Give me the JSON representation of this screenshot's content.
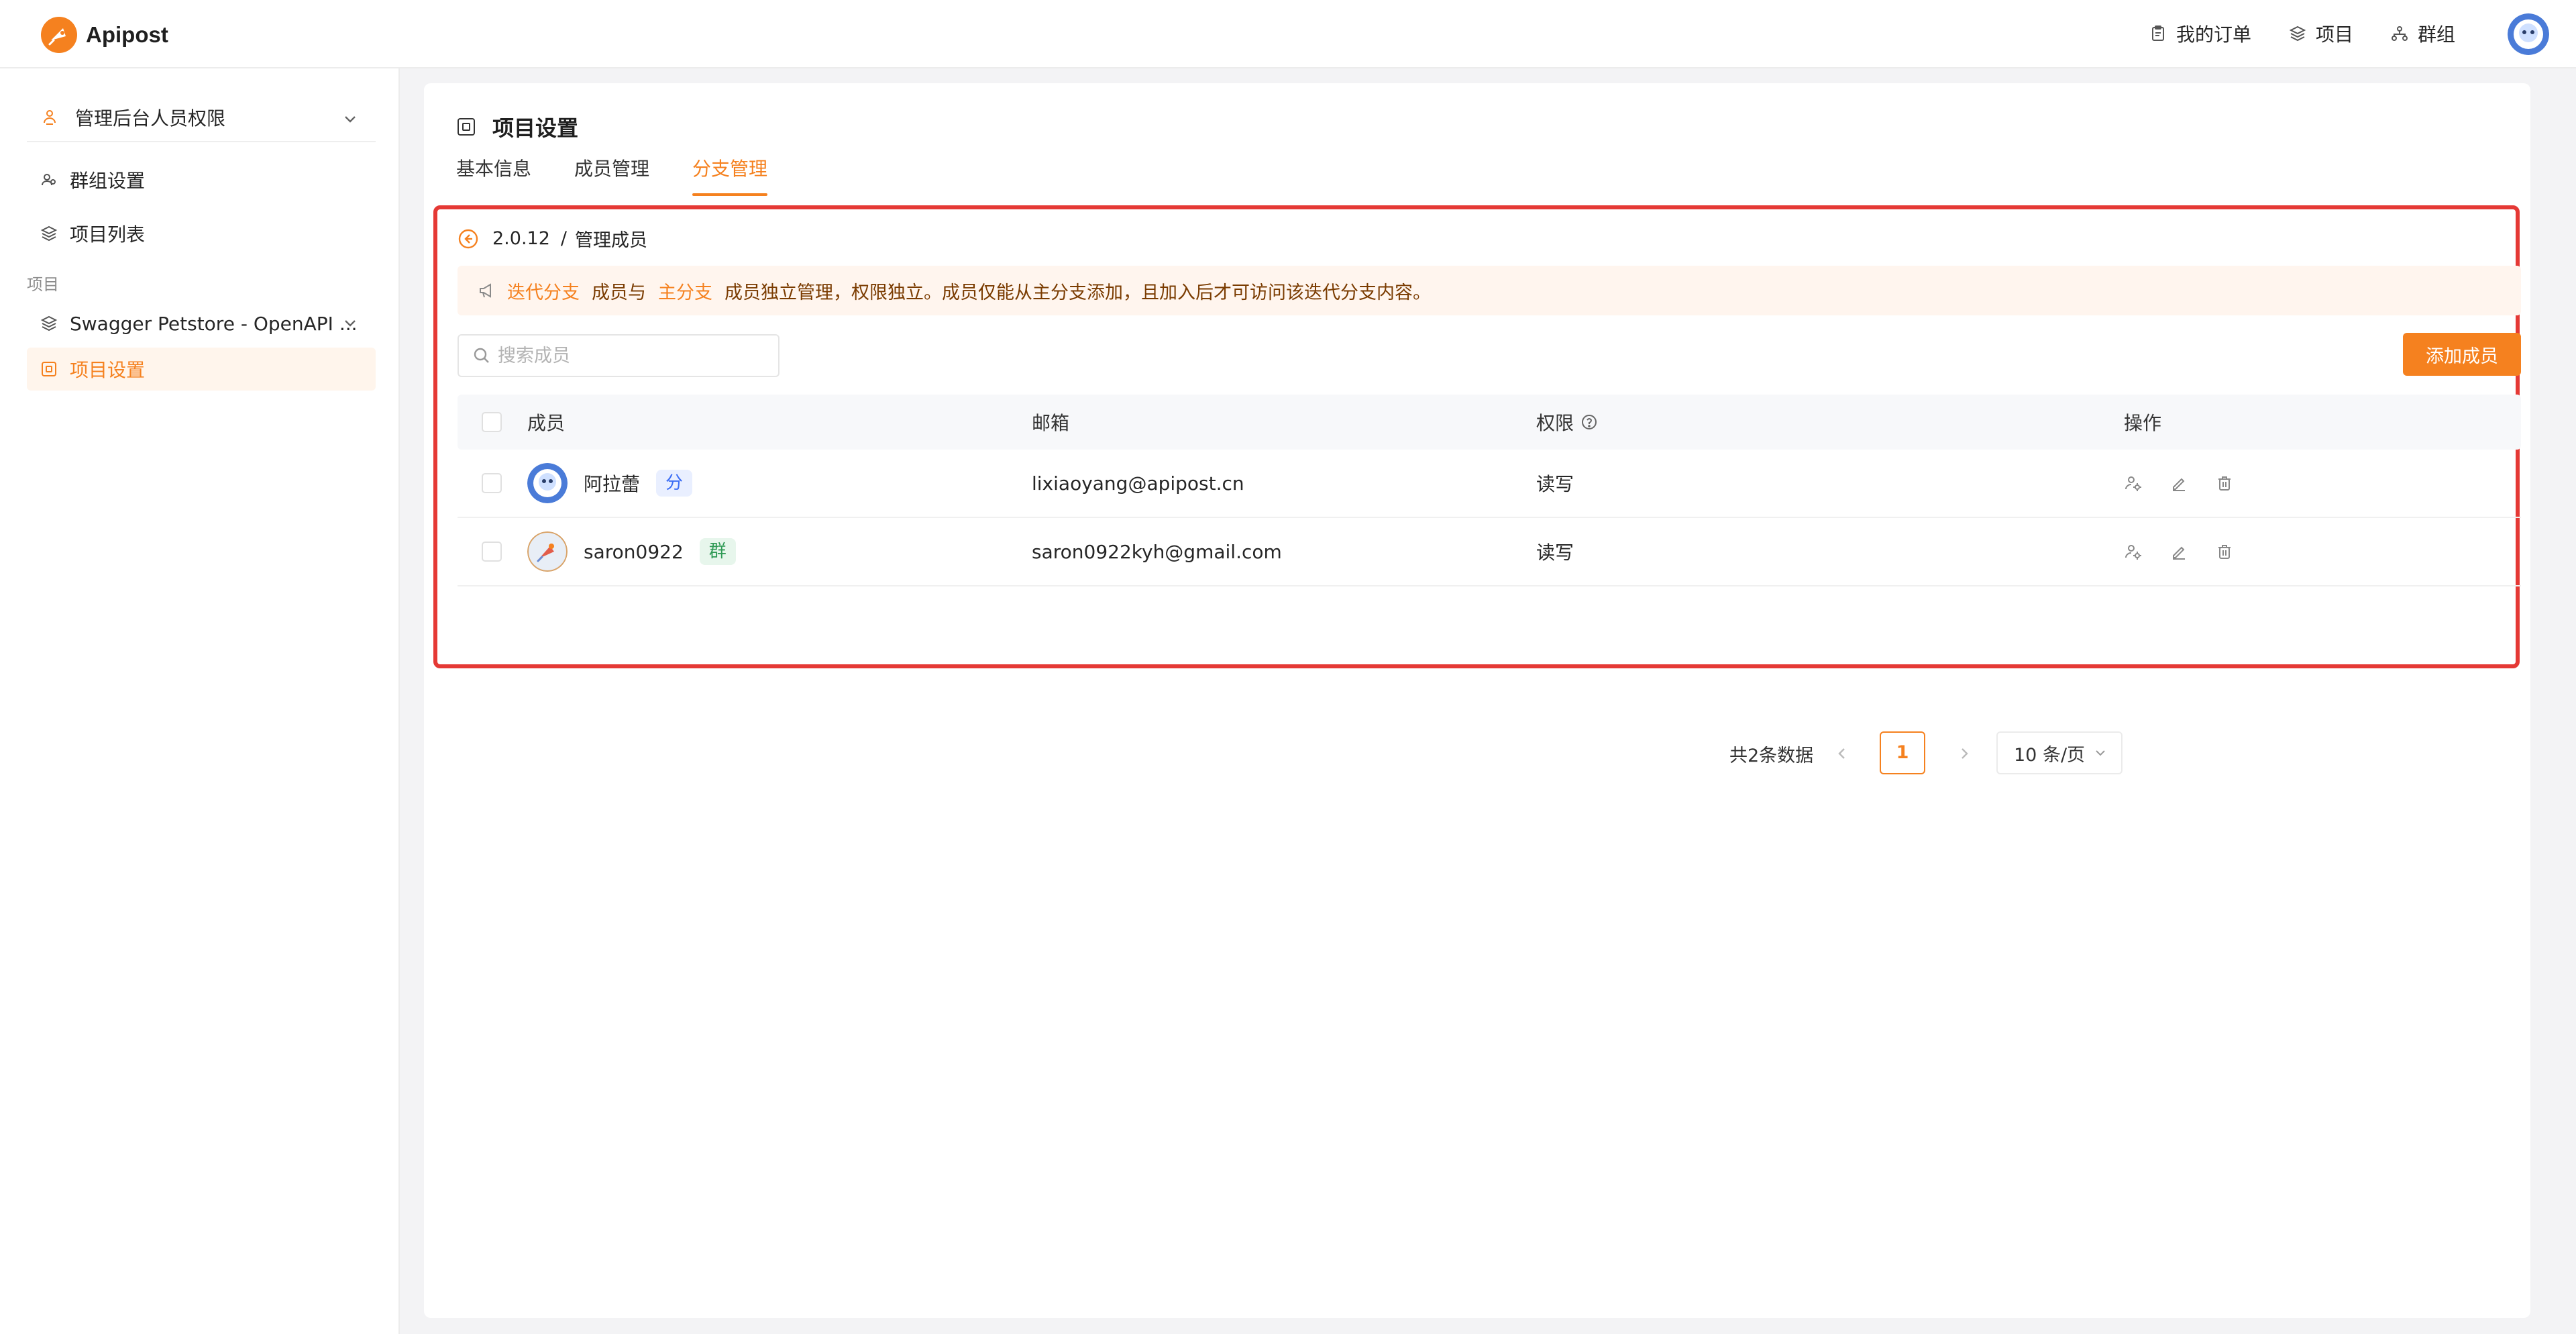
{
  "app": {
    "name": "Apipost"
  },
  "topnav": {
    "items": [
      {
        "label": "我的订单",
        "icon": "clipboard-icon"
      },
      {
        "label": "项目",
        "icon": "layers-icon"
      },
      {
        "label": "群组",
        "icon": "org-icon"
      }
    ]
  },
  "sidebar": {
    "team_select": "管理后台人员权限",
    "items": [
      {
        "label": "群组设置",
        "icon": "group-icon"
      },
      {
        "label": "项目列表",
        "icon": "layers-icon"
      }
    ],
    "section_label": "项目",
    "project": "Swagger Petstore - OpenAPI ...",
    "active_item": "项目设置"
  },
  "main": {
    "title": "项目设置",
    "tabs": [
      {
        "label": "基本信息",
        "active": false
      },
      {
        "label": "成员管理",
        "active": false
      },
      {
        "label": "分支管理",
        "active": true
      }
    ],
    "breadcrumb": {
      "version": "2.0.12",
      "separator": "/",
      "current": "管理成员"
    },
    "notice": {
      "hl1": "迭代分支",
      "text1": "成员与",
      "hl2": "主分支",
      "text2": "成员独立管理，权限独立。成员仅能从主分支添加，且加入后才可访问该迭代分支内容。"
    },
    "search": {
      "placeholder": "搜索成员",
      "value": ""
    },
    "add_button": "添加成员",
    "table": {
      "headers": {
        "member": "成员",
        "email": "邮箱",
        "permission": "权限",
        "actions": "操作"
      },
      "rows": [
        {
          "name": "阿拉蕾",
          "tag": "分",
          "email": "lixiaoyang@apipost.cn",
          "permission": "读写"
        },
        {
          "name": "saron0922",
          "tag": "群",
          "email": "saron0922kyh@gmail.com",
          "permission": "读写"
        }
      ]
    },
    "pagination": {
      "total": "共2条数据",
      "page": "1",
      "page_size": "10 条/页"
    }
  },
  "colors": {
    "accent": "#f5811f",
    "frame": "#e53935",
    "tag_blue": "#3b6df5",
    "tag_green": "#2f9a55"
  }
}
